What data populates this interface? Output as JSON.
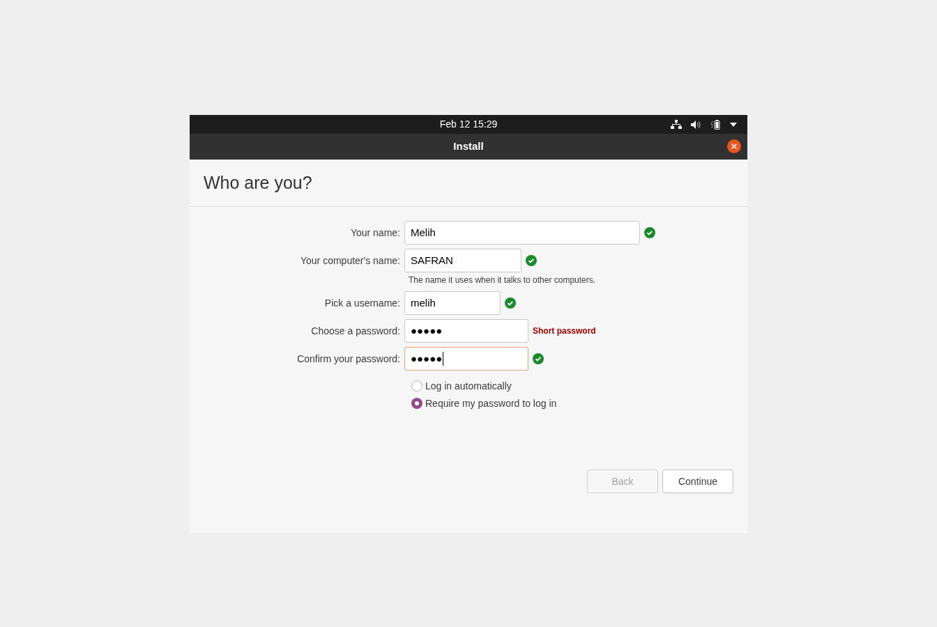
{
  "top_bar": {
    "clock": "Feb 12  15:29"
  },
  "window": {
    "title": "Install"
  },
  "heading": "Who are you?",
  "fields": [
    {
      "label": "Your name:",
      "value": "Melih",
      "valid": true,
      "focused": false
    },
    {
      "label": "Your computer's name:",
      "value": "SAFRAN",
      "valid": true,
      "focused": false,
      "hint": "The name it uses when it talks to other computers."
    },
    {
      "label": "Pick a username:",
      "value": "melih",
      "valid": true,
      "focused": false
    },
    {
      "label": "Choose a password:",
      "value": "●●●●●",
      "valid": false,
      "focused": false,
      "error": "Short password"
    },
    {
      "label": "Confirm your password:",
      "value": "●●●●●",
      "valid": true,
      "focused": true
    }
  ],
  "login_options": [
    {
      "label": "Log in automatically",
      "selected": false
    },
    {
      "label": "Require my password to log in",
      "selected": true
    }
  ],
  "buttons": [
    {
      "label": "Back",
      "disabled": true
    },
    {
      "label": "Continue",
      "disabled": false
    }
  ]
}
